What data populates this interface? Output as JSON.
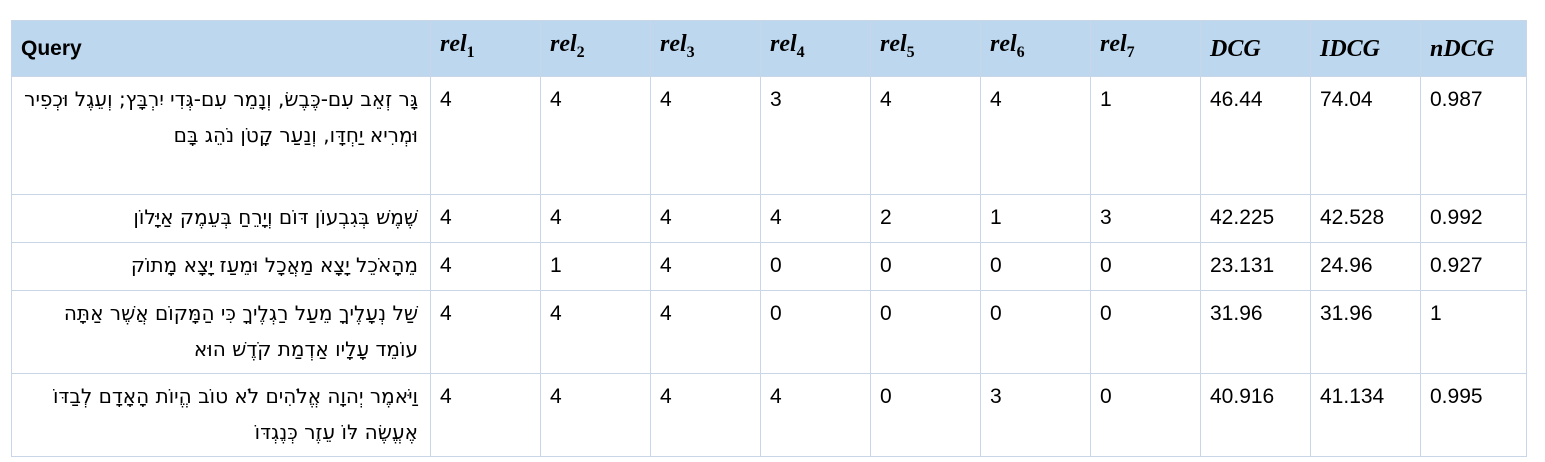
{
  "table": {
    "headers": {
      "query": "Query",
      "rel_base": "rel",
      "rel_subs": [
        "1",
        "2",
        "3",
        "4",
        "5",
        "6",
        "7"
      ],
      "dcg": "DCG",
      "idcg": "IDCG",
      "ndcg": "nDCG"
    },
    "rows": [
      {
        "query": "גָּר זְאֵב עִם-כֶּבֶשׂ, וְנָמֵר עִם-גְּדִי יִרְבָּץ; וְעֵגֶל וּכְפִיר וּמְרִיא יַחְדָּו, וְנַעַר קָטֹן נֹהֵג בָּם",
        "rels": [
          "4",
          "4",
          "4",
          "3",
          "4",
          "4",
          "1"
        ],
        "dcg": "46.44",
        "idcg": "74.04",
        "ndcg": "0.987"
      },
      {
        "query": "שֶׁמֶשׁ בְּגִבְעוֹן דּוֹם וְיָרֵחַ בְּעֵמֶק אַיָּלוֹן",
        "rels": [
          "4",
          "4",
          "4",
          "4",
          "2",
          "1",
          "3"
        ],
        "dcg": "42.225",
        "idcg": "42.528",
        "ndcg": "0.992"
      },
      {
        "query": "מֵהָאֹכֵל יָצָא מַאֲכָל וּמֵעַז יָצָא מָתוֹק",
        "rels": [
          "4",
          "1",
          "4",
          "0",
          "0",
          "0",
          "0"
        ],
        "dcg": "23.131",
        "idcg": "24.96",
        "ndcg": "0.927"
      },
      {
        "query": "שַׁל נְעָלֶיךָ מֵעַל רַגְלֶיךָ כִּי הַמָּקוֹם אֲשֶׁר אַתָּה עוֹמֵד עָלָיו אַדְמַת קֹדֶשׁ הוּא",
        "rels": [
          "4",
          "4",
          "4",
          "0",
          "0",
          "0",
          "0"
        ],
        "dcg": "31.96",
        "idcg": "31.96",
        "ndcg": "1"
      },
      {
        "query": "וַיֹּאמֶר יְהוָה אֱלֹהִים לֹא טוֹב הֱיוֹת הָאָדָם לְבַדּוֹ אֶעֱשֶׂה לּוֹ עֵזֶר כְּנֶגְדּוֹ",
        "rels": [
          "4",
          "4",
          "4",
          "4",
          "0",
          "3",
          "0"
        ],
        "dcg": "40.916",
        "idcg": "41.134",
        "ndcg": "0.995"
      }
    ]
  }
}
